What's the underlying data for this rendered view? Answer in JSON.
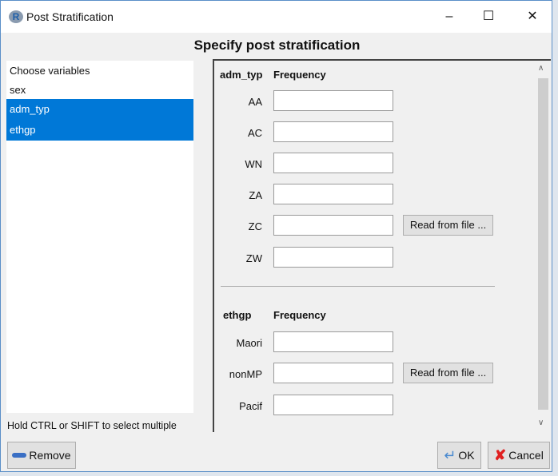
{
  "window": {
    "title": "Post Stratification"
  },
  "heading": "Specify post stratification",
  "variables": {
    "items": [
      {
        "label": "Choose variables",
        "selected": false
      },
      {
        "label": "sex",
        "selected": false
      },
      {
        "label": "adm_typ",
        "selected": true
      },
      {
        "label": "ethgp",
        "selected": true
      }
    ],
    "hint": "Hold CTRL or SHIFT to select multiple"
  },
  "groups": [
    {
      "name": "adm_typ",
      "freq_header": "Frequency",
      "levels": [
        "AA",
        "AC",
        "WN",
        "ZA",
        "ZC",
        "ZW"
      ],
      "read_button": "Read from file ..."
    },
    {
      "name": "ethgp",
      "freq_header": "Frequency",
      "levels": [
        "Maori",
        "nonMP",
        "Pacif"
      ],
      "read_button": "Read from file ..."
    }
  ],
  "buttons": {
    "remove": "Remove",
    "ok": "OK",
    "cancel": "Cancel"
  },
  "colors": {
    "selection": "#0078d7"
  }
}
